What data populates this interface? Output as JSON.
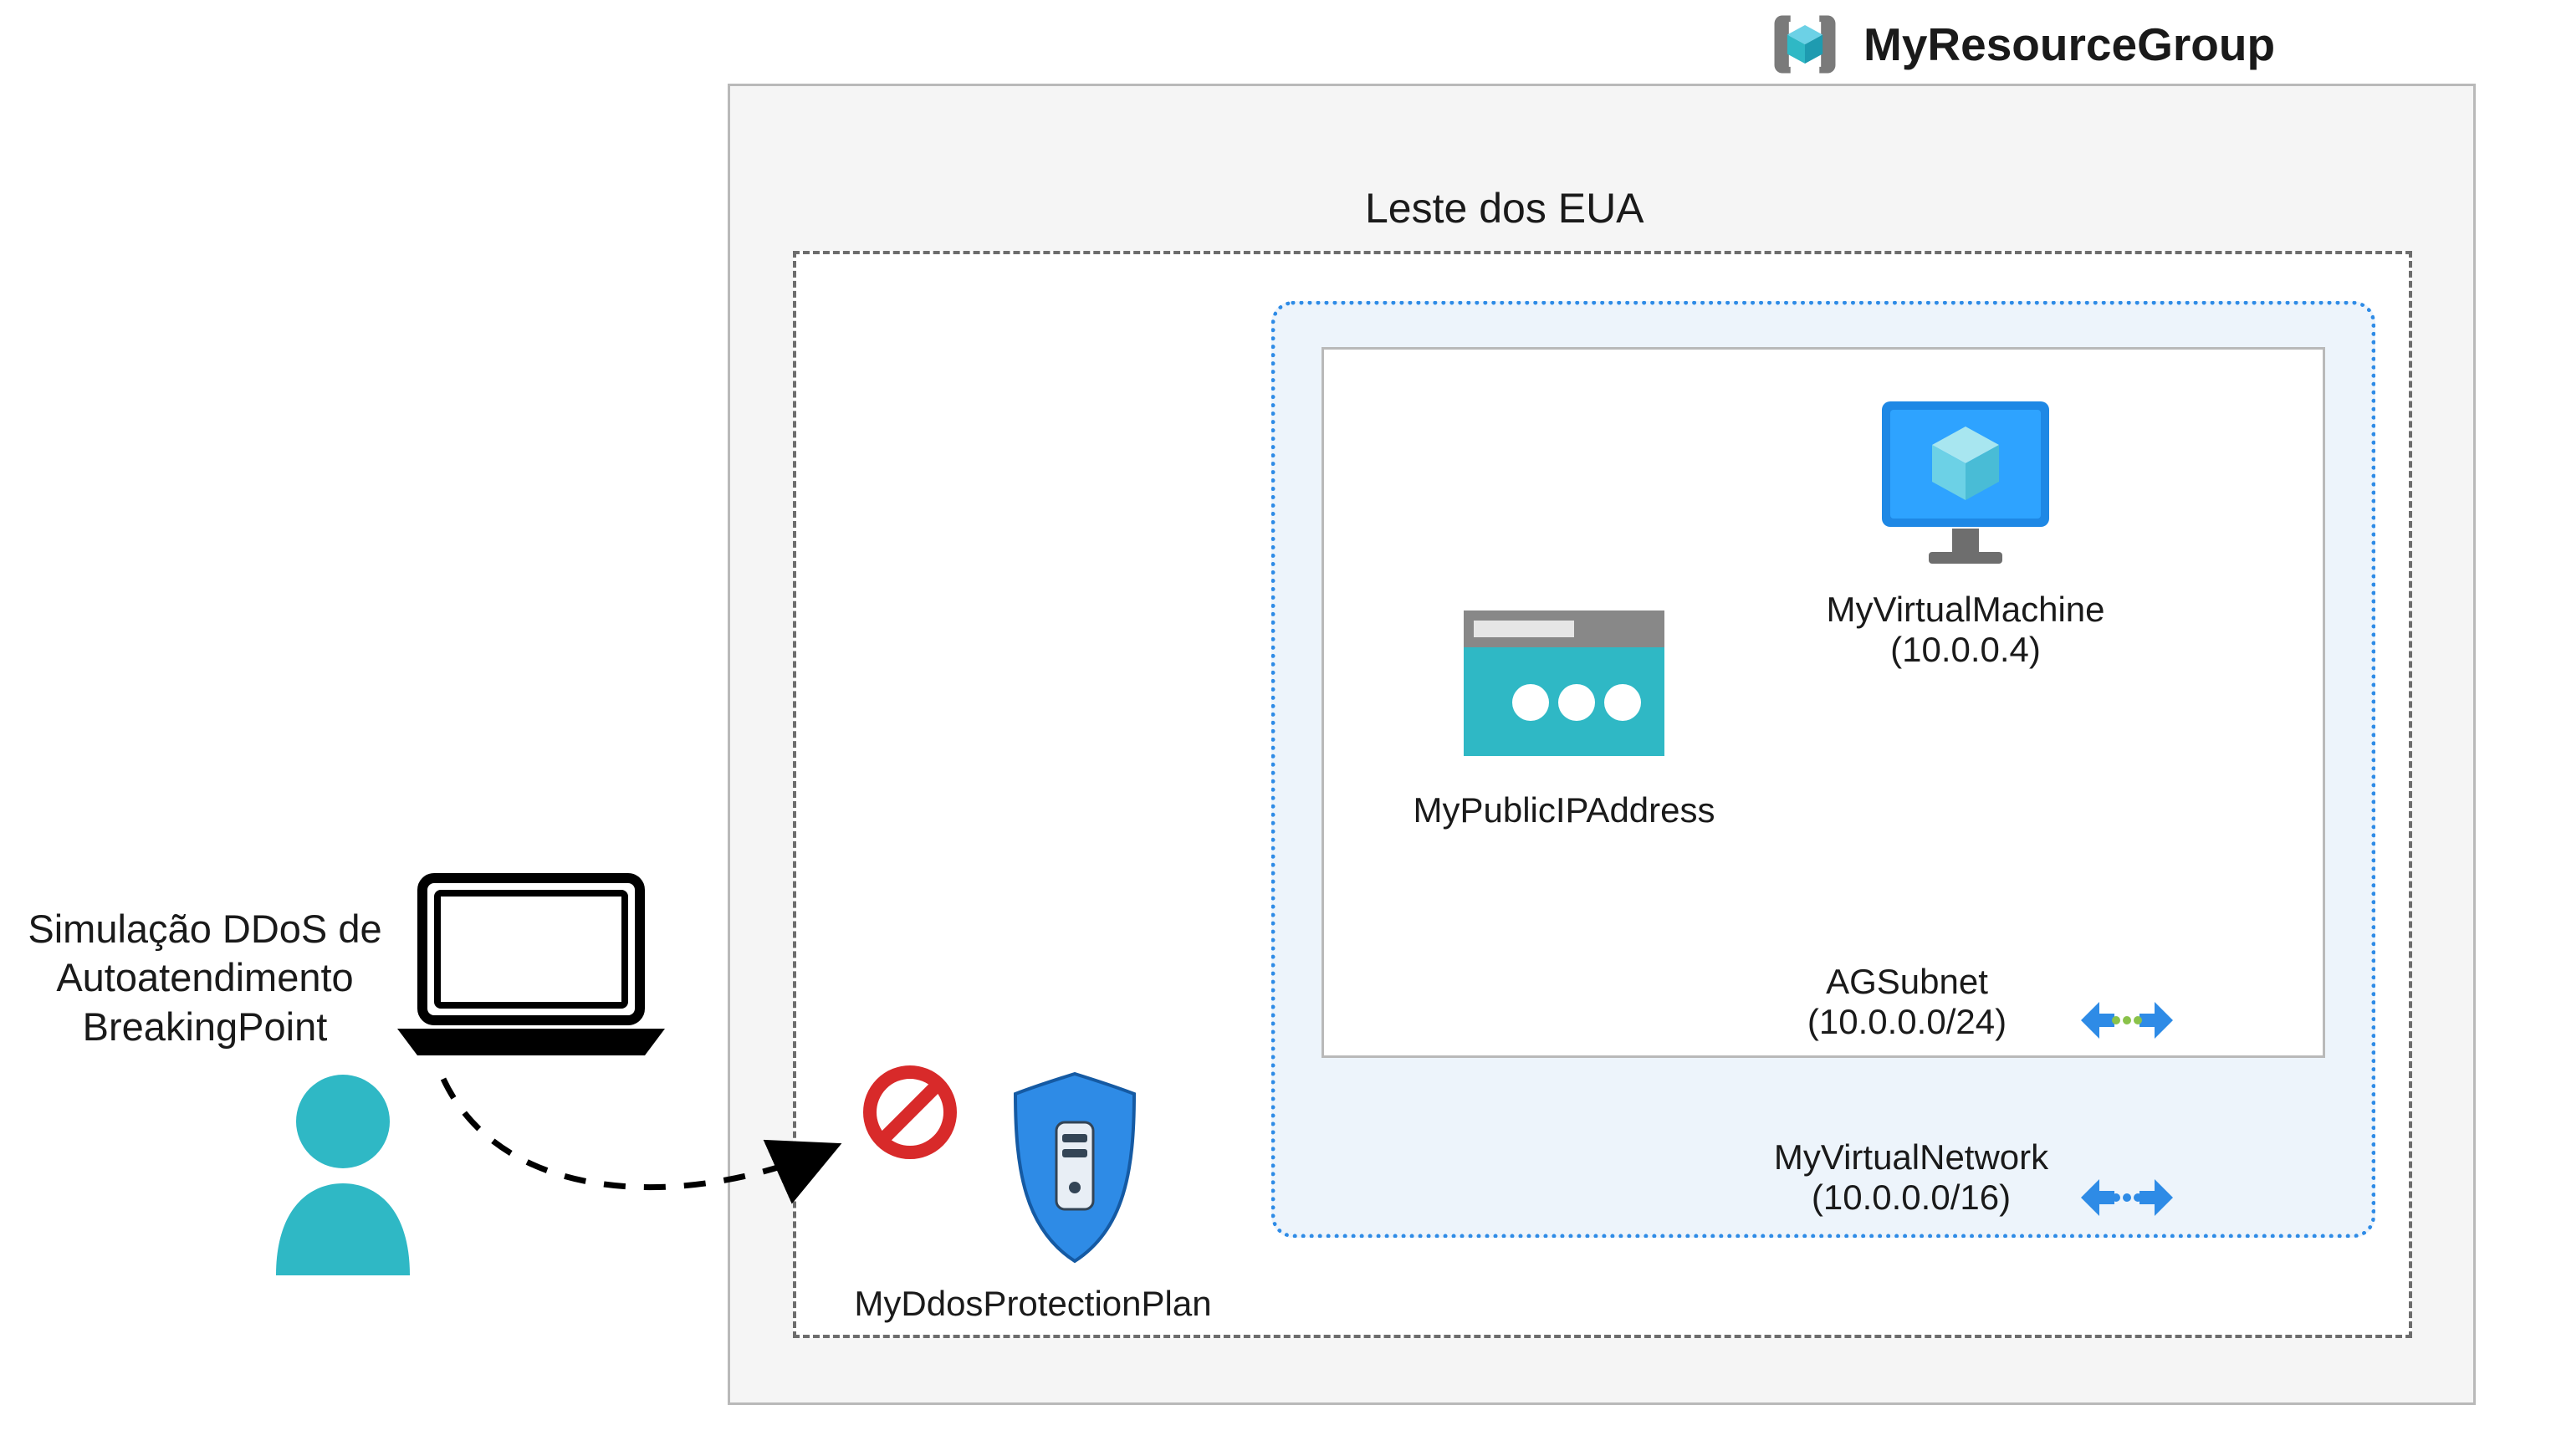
{
  "resource_group": {
    "title": "MyResourceGroup"
  },
  "region": {
    "title": "Leste dos EUA"
  },
  "vnet": {
    "name": "MyVirtualNetwork",
    "cidr": "(10.0.0.0/16)"
  },
  "subnet": {
    "name": "AGSubnet",
    "cidr": "(10.0.0.0/24)"
  },
  "vm": {
    "name": "MyVirtualMachine",
    "ip": "(10.0.0.4)"
  },
  "public_ip": {
    "name": "MyPublicIPAddress"
  },
  "ddos": {
    "name": "MyDdosProtectionPlan"
  },
  "sim": {
    "line1": "Simulação DDoS de",
    "line2": "Autoatendimento",
    "line3": "BreakingPoint"
  },
  "colors": {
    "azure_blue": "#2e8be6",
    "teal": "#2fb8c5",
    "dark": "#1a1a1a",
    "grey_border": "#b9b9b9",
    "light_grey": "#f5f5f5",
    "light_blue_fill": "#edf4fb",
    "forbidden_red": "#d82a2a"
  }
}
